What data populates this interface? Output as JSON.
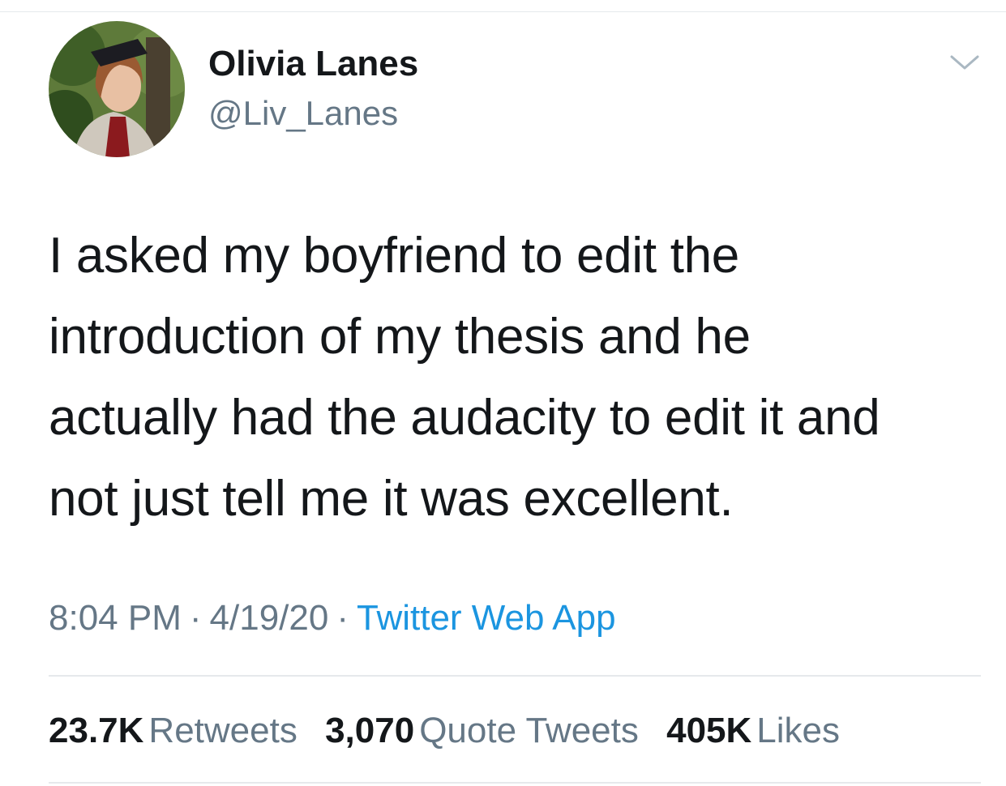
{
  "author": {
    "display_name": "Olivia Lanes",
    "handle": "@Liv_Lanes"
  },
  "tweet": {
    "text_lines": [
      "I asked my boyfriend to edit the",
      "introduction of my thesis and he",
      "actually had the audacity to edit it and",
      "not just tell me it was excellent."
    ]
  },
  "meta": {
    "time": "8:04 PM",
    "date": "4/19/20",
    "separator": "·",
    "source": "Twitter Web App"
  },
  "stats": {
    "retweets_count": "23.7K",
    "retweets_label": "Retweets",
    "quotes_count": "3,070",
    "quotes_label": "Quote Tweets",
    "likes_count": "405K",
    "likes_label": "Likes"
  },
  "colors": {
    "text_primary": "#14171a",
    "text_secondary": "#657786",
    "link": "#1b95e0",
    "divider": "#e6e9ec"
  },
  "icons": {
    "menu": "chevron-down-icon"
  }
}
